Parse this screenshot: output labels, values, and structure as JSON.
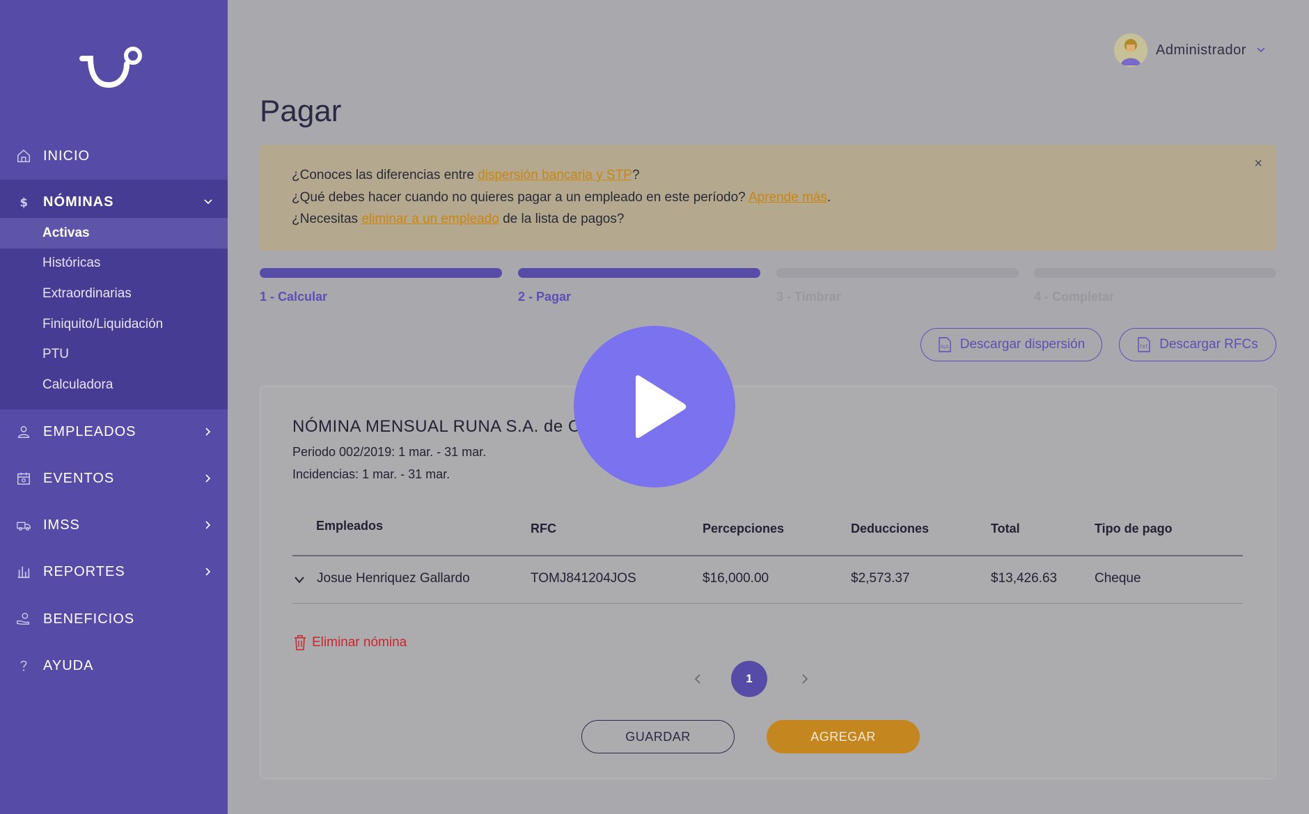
{
  "sidebar": {
    "nav": [
      {
        "label": "INICIO",
        "icon": "home-icon"
      },
      {
        "label": "NÓMINAS",
        "icon": "dollar-icon"
      },
      {
        "label": "EMPLEADOS",
        "icon": "user-icon"
      },
      {
        "label": "EVENTOS",
        "icon": "calendar-icon"
      },
      {
        "label": "IMSS",
        "icon": "ambulance-icon"
      },
      {
        "label": "REPORTES",
        "icon": "bar-chart-icon"
      },
      {
        "label": "BENEFICIOS",
        "icon": "hand-coin-icon"
      },
      {
        "label": "AYUDA",
        "icon": "question-icon"
      }
    ],
    "nominas_sub": [
      "Activas",
      "Históricas",
      "Extraordinarias",
      "Finiquito/Liquidación",
      "PTU",
      "Calculadora"
    ]
  },
  "user": {
    "name": "Administrador"
  },
  "page": {
    "title": "Pagar"
  },
  "notice": {
    "line1_pre": "¿Conoces las diferencias entre ",
    "line1_link": "dispersión bancaria y STP",
    "line1_post": "?",
    "line2_pre": "¿Qué debes hacer cuando no quieres pagar a un empleado en este período? ",
    "line2_link": "Aprende más",
    "line2_post": ".",
    "line3_pre": "¿Necesitas ",
    "line3_link": "eliminar a un empleado",
    "line3_post": " de la lista de pagos?",
    "close": "×"
  },
  "steps": [
    {
      "label": "1 - Calcular",
      "done": true
    },
    {
      "label": "2 - Pagar",
      "done": true
    },
    {
      "label": "3 - Timbrar",
      "done": false
    },
    {
      "label": "4 - Completar",
      "done": false
    }
  ],
  "actions": {
    "download_dispersion": "Descargar dispersión",
    "download_rfcs": "Descargar RFCs"
  },
  "card": {
    "title": "NÓMINA MENSUAL RUNA S.A. de C",
    "period": "Periodo 002/2019: 1 mar. - 31 mar.",
    "incidencias": "Incidencias: 1 mar. - 31 mar.",
    "columns": [
      "Empleados",
      "RFC",
      "Percepciones",
      "Deducciones",
      "Total",
      "Tipo de pago"
    ],
    "rows": [
      {
        "empleado": "Josue Henriquez Gallardo",
        "rfc": "TOMJ841204JOS",
        "percepciones": "$16,000.00",
        "deducciones": "$2,573.37",
        "total": "$13,426.63",
        "tipo": "Cheque"
      }
    ],
    "delete_label": "Eliminar nómina",
    "page": "1",
    "save": "GUARDAR",
    "add": "AGREGAR"
  },
  "colors": {
    "accent": "#574ba8",
    "link": "#c98610",
    "danger": "#c9262d",
    "add_button": "#c4861e",
    "play": "#7a72ef"
  }
}
